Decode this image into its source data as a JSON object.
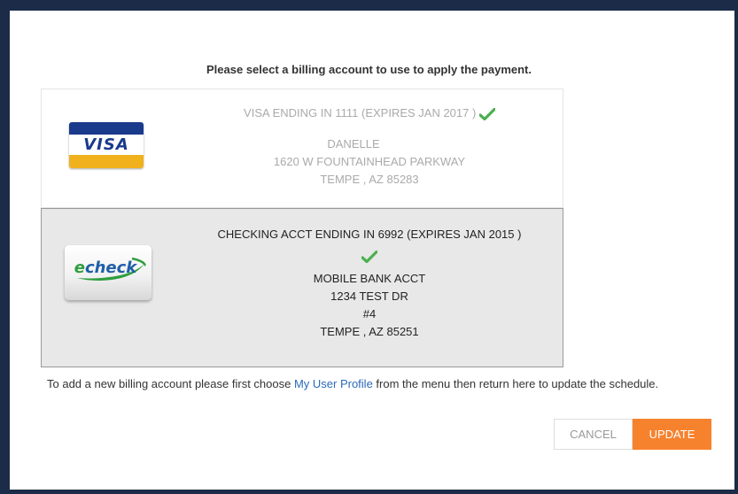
{
  "dialog": {
    "heading": "Please select a billing account to use to apply the payment."
  },
  "accounts": [
    {
      "card_type": "VISA",
      "icon": "visa-card-icon",
      "title": "VISA ENDING IN 1111 (EXPIRES JAN 2017 )",
      "name": "DANELLE",
      "address_lines": [
        "1620 W FOUNTAINHEAD PARKWAY",
        "TEMPE , AZ 85283"
      ],
      "selected": false
    },
    {
      "card_type": "echeck",
      "icon": "echeck-icon",
      "title": "CHECKING ACCT ENDING IN 6992 (EXPIRES JAN 2015 )",
      "name": "MOBILE BANK ACCT",
      "address_lines": [
        "1234 TEST DR",
        "#4",
        "TEMPE , AZ 85251"
      ],
      "selected": true
    }
  ],
  "note": {
    "before": "To add a new billing account please first choose ",
    "link": "My User Profile",
    "after": " from the menu then return here to update the schedule."
  },
  "buttons": {
    "cancel": "CANCEL",
    "update": "UPDATE"
  },
  "colors": {
    "frame": "#1b2b48",
    "check": "#4caf50",
    "update_button": "#f7822e",
    "link": "#2a6ab8",
    "selected_row": "#e8e8e8"
  }
}
